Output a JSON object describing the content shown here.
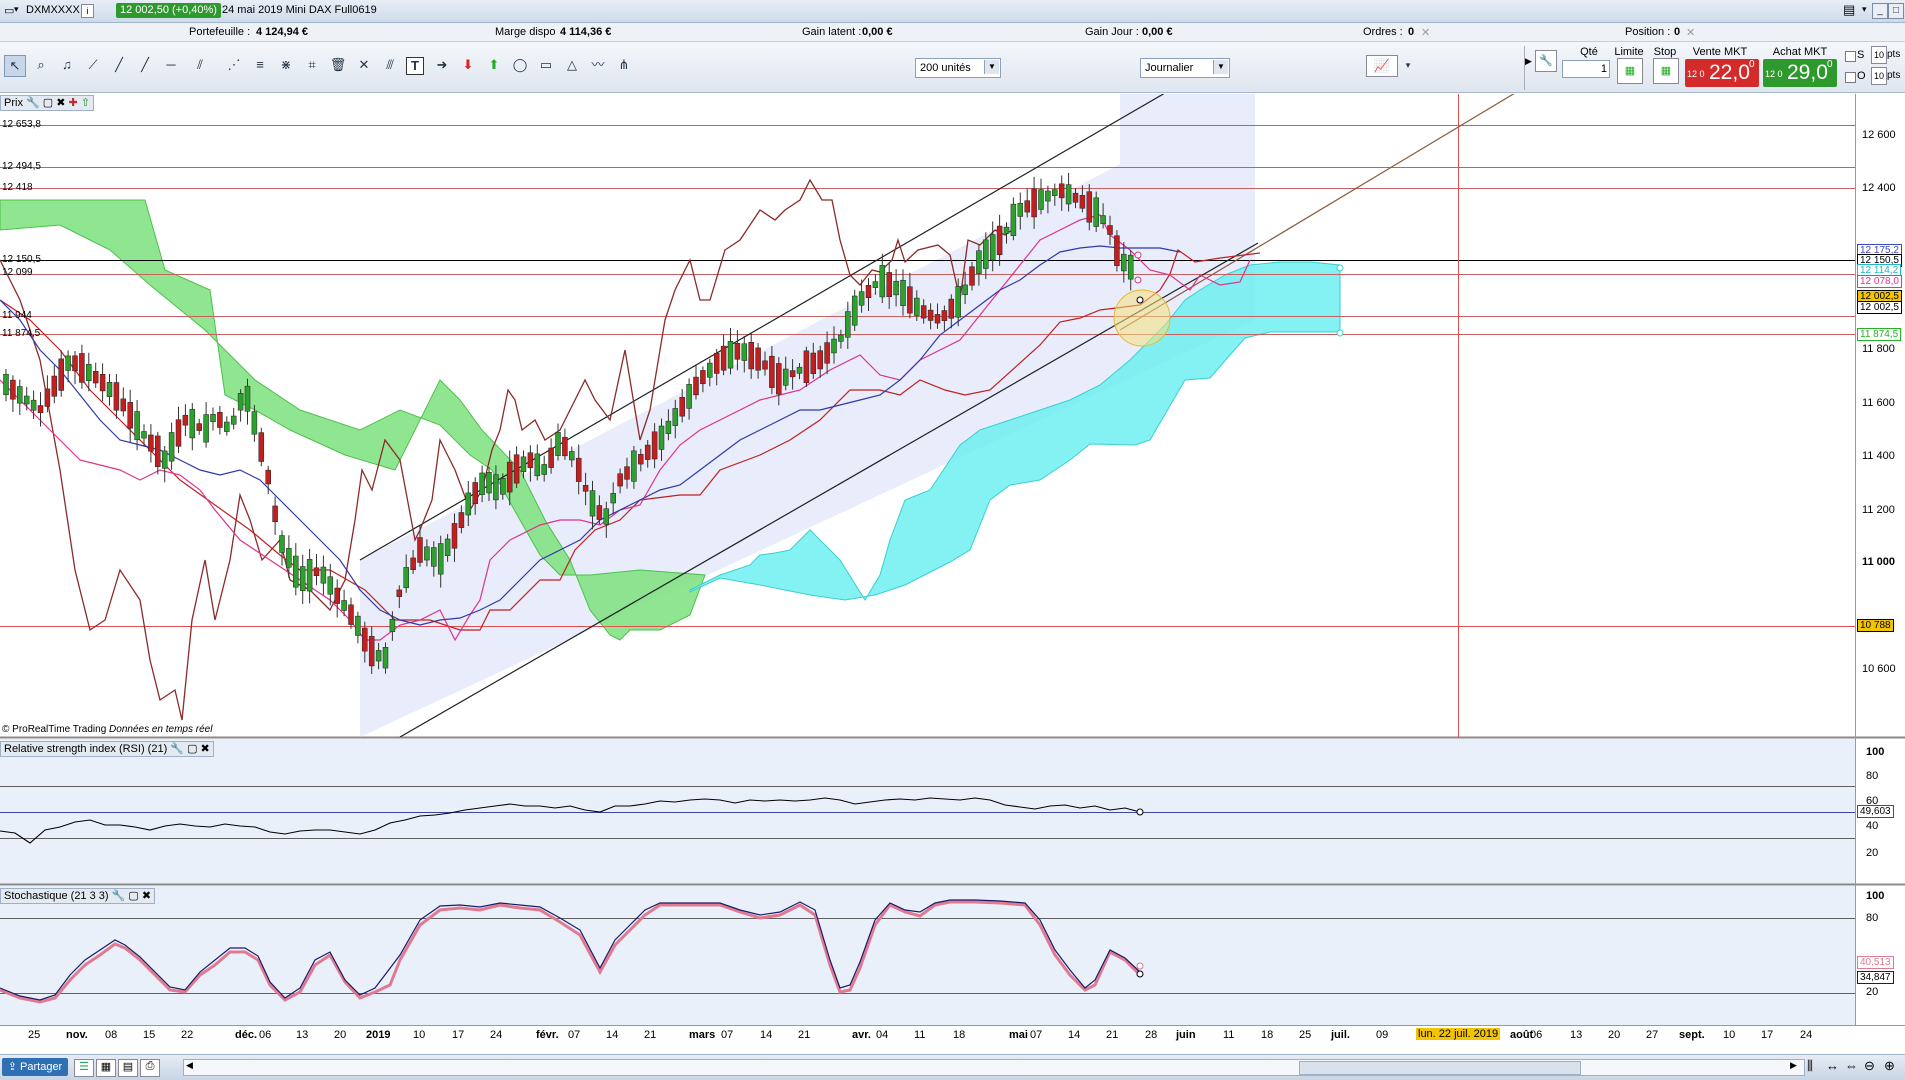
{
  "titlebar": {
    "ticker": "DXMXXXX",
    "price": "12 002,50 (+0,40%)",
    "subtitle": "24 mai 2019  Mini DAX Full0619"
  },
  "infobar": {
    "portefeuille_label": "Portefeuille :",
    "portefeuille_value": "4 124,94 €",
    "marge_label": "Marge dispo",
    "marge_value": "4 114,36 €",
    "gain_latent_label": "Gain latent :",
    "gain_latent_value": "0,00 €",
    "gain_jour_label": "Gain Jour :",
    "gain_jour_value": "0,00 €",
    "ordres_label": "Ordres :",
    "ordres_value": "0",
    "position_label": "Position :",
    "position_value": "0"
  },
  "toolbar": {
    "units_value": "200 unités",
    "period_value": "Journalier"
  },
  "order_panel": {
    "qty_label": "Qté",
    "qty_value": "1",
    "limit_label": "Limite",
    "stop_label": "Stop",
    "sell_label": "Vente MKT",
    "sell_prefix": "12 0",
    "sell_value": "22,0",
    "sell_sup": "0",
    "buy_label": "Achat MKT",
    "buy_prefix": "12 0",
    "buy_value": "29,0",
    "buy_sup": "0",
    "s_label": "S",
    "o_label": "O",
    "pts_value": "10",
    "pts_label": "pts"
  },
  "price_panel": {
    "tab_label": "Prix",
    "watermark": "© ProRealTime Trading",
    "watermark_italic": "Données en temps réel",
    "left_levels": [
      "12 653,8",
      "12 494,5",
      "12 418",
      "12 150,5",
      "12 099",
      "11 944",
      "11 874,5"
    ],
    "right_axis": [
      "12 600",
      "12 400",
      "11 800",
      "11 600",
      "11 400",
      "11 200",
      "11 000",
      "10 600"
    ],
    "right_tags": [
      {
        "text": "12 175,2",
        "color": "#3a46c8",
        "bg": "#ffffff"
      },
      {
        "text": "12 150,5",
        "color": "#000000",
        "bg": "#ffffff"
      },
      {
        "text": "12 114,2",
        "color": "#1fb8c8",
        "bg": "#ffffff"
      },
      {
        "text": "12 078,0",
        "color": "#e0338c",
        "bg": "#ffffff"
      },
      {
        "text": "12 002,5",
        "color": "#000000",
        "bg": "#f3c400"
      },
      {
        "text": "12 002,5",
        "color": "#000000",
        "bg": "#ffffff"
      },
      {
        "text": "11 874,5",
        "color": "#25b325",
        "bg": "#ffffff"
      },
      {
        "text": "10 788",
        "color": "#000000",
        "bg": "#f3c400"
      }
    ]
  },
  "rsi_panel": {
    "tab_label": "Relative strength index (RSI) (21)",
    "axis": [
      "100",
      "80",
      "60",
      "40",
      "20"
    ],
    "value_tag": "49,603"
  },
  "stoch_panel": {
    "tab_label": "Stochastique (21 3 3)",
    "axis": [
      "100",
      "80",
      "20"
    ],
    "value_tags": [
      "40,513",
      "34,847"
    ]
  },
  "date_axis": [
    "25",
    "nov.",
    "08",
    "15",
    "22",
    "déc.",
    "06",
    "13",
    "20",
    "2019",
    "10",
    "17",
    "24",
    "févr.",
    "07",
    "14",
    "21",
    "mars",
    "07",
    "14",
    "21",
    "avr.",
    "04",
    "11",
    "18",
    "mai",
    "07",
    "14",
    "21",
    "28",
    "juin",
    "11",
    "18",
    "25",
    "juil.",
    "09",
    "août",
    "06",
    "13",
    "20",
    "27",
    "sept.",
    "10",
    "17",
    "24"
  ],
  "cursor_date": "lun. 22 juil. 2019",
  "statusbar": {
    "share_label": "Partager"
  }
}
